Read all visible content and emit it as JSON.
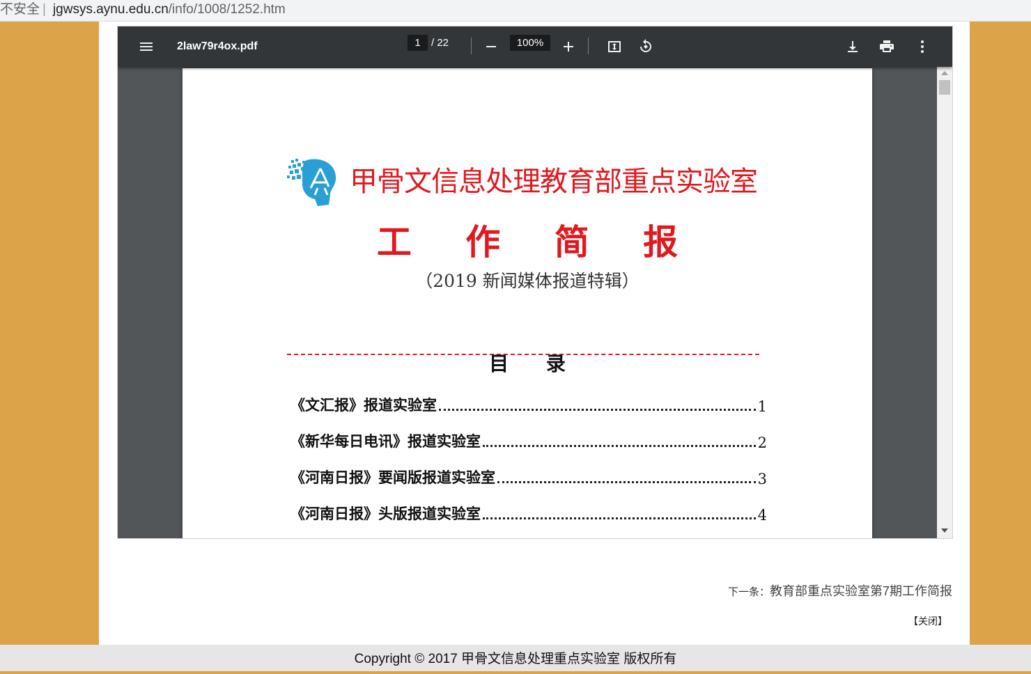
{
  "browser": {
    "security_label": "不安全",
    "url_host": "jgwsys.aynu.edu.cn",
    "url_path": "/info/1008/1252.htm"
  },
  "pdf_viewer": {
    "filename": "2law79r4ox.pdf",
    "current_page": "1",
    "total_pages": "/ 22",
    "zoom": "100%",
    "icons": [
      "menu-icon",
      "zoom-out-icon",
      "zoom-in-icon",
      "fit-page-icon",
      "rotate-icon",
      "download-icon",
      "print-icon",
      "more-vert-icon"
    ]
  },
  "document": {
    "lab_title": "甲骨文信息处理教育部重点实验室",
    "brief_title": "工 作 简 报",
    "special_edition": "（2019 新闻媒体报道特辑）",
    "toc_heading": "目 录",
    "toc": [
      {
        "title": "《文汇报》报道实验室",
        "page": "1"
      },
      {
        "title": "《新华每日电讯》报道实验室",
        "page": "2"
      },
      {
        "title": "《河南日报》要闻版报道实验室",
        "page": "3"
      },
      {
        "title": "《河南日报》头版报道实验室",
        "page": "4"
      }
    ]
  },
  "page": {
    "next_label": "下一条：",
    "next_title": "教育部重点实验室第7期工作简报",
    "close_label": "【关闭】"
  },
  "footer": {
    "copyright": "Copyright © 2017 甲骨文信息处理重点实验室 版权所有"
  },
  "colors": {
    "background": "#dca349",
    "toolbar": "#323639",
    "viewer_bg": "#525659",
    "title_red": "#e0191f"
  }
}
